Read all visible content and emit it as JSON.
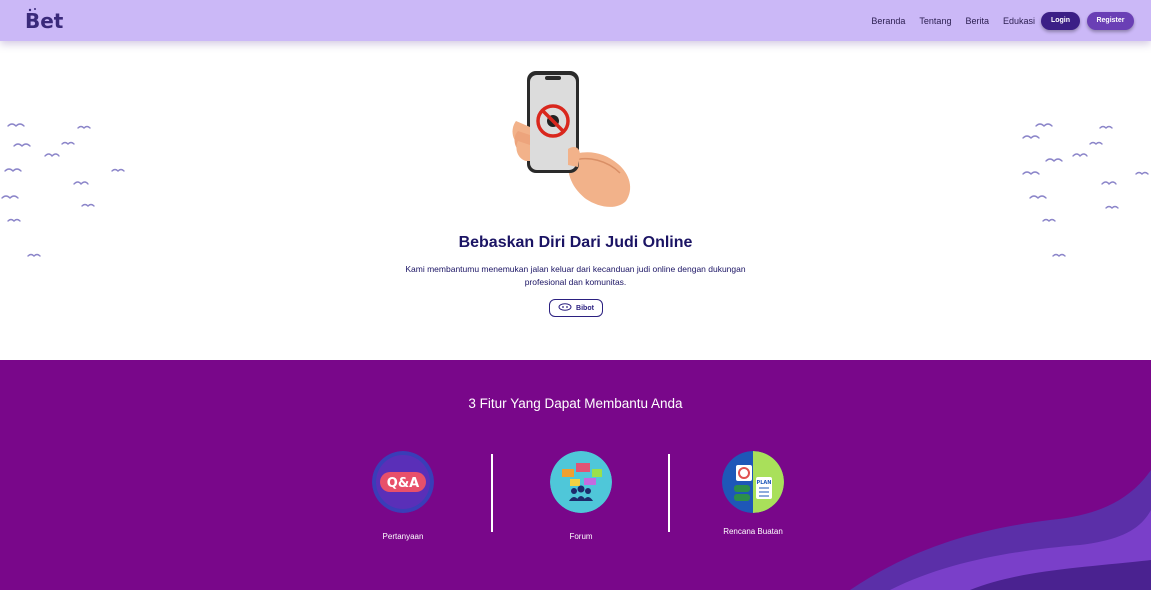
{
  "brand": {
    "logo_text": "Bet"
  },
  "nav": {
    "items": [
      "Beranda",
      "Tentang",
      "Berita",
      "Edukasi"
    ],
    "login_label": "Login",
    "register_label": "Register"
  },
  "hero": {
    "title": "Bebaskan Diri Dari Judi Online",
    "subtitle": "Kami membantumu menemukan jalan keluar dari kecanduan judi online dengan dukungan profesional dan komunitas.",
    "bibot_label": "Bibot"
  },
  "features": {
    "title": "3 Fitur Yang Dapat Membantu Anda",
    "items": [
      {
        "label": "Pertanyaan",
        "icon": "qa-icon",
        "badge": "Q&A"
      },
      {
        "label": "Forum",
        "icon": "forum-icon"
      },
      {
        "label": "Rencana Buatan",
        "icon": "plan-icon",
        "badge": "PLAN"
      }
    ]
  },
  "colors": {
    "header_bg": "#cbb8f7",
    "features_bg": "#79078a",
    "title_text": "#1b1464",
    "login_btn": "#3b1f86",
    "register_btn": "#6a3fb5"
  }
}
